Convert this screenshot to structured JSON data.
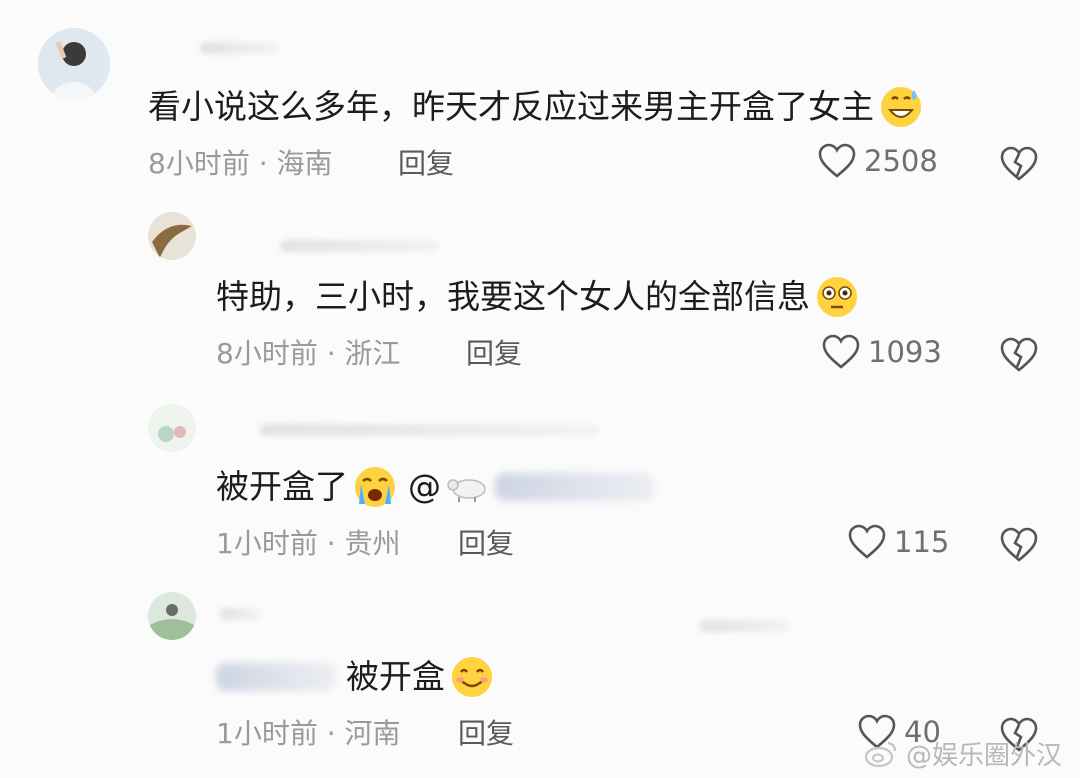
{
  "comments": [
    {
      "text": "看小说这么多年，昨天才反应过来男主开盒了女主",
      "emoji": "grinning-sweat-emoji",
      "time": "8小时前",
      "location": "海南",
      "reply_label": "回复",
      "likes": "2508"
    },
    {
      "text": "特助，三小时，我要这个女人的全部信息",
      "emoji": "flushed-emoji",
      "time": "8小时前",
      "location": "浙江",
      "reply_label": "回复",
      "likes": "1093"
    },
    {
      "text": "被开盒了",
      "emoji": "crying-emoji",
      "mention": "@",
      "time": "1小时前",
      "location": "贵州",
      "reply_label": "回复",
      "likes": "115"
    },
    {
      "text": "被开盒",
      "emoji": "smiling-emoji",
      "time": "1小时前",
      "location": "河南",
      "reply_label": "回复",
      "likes": "40"
    }
  ],
  "separator": " · ",
  "watermark": "@娱乐圈外汉",
  "colors": {
    "text": "#1c1c1c",
    "meta": "#9a9a9a",
    "emoji_face": "#ffd23f",
    "background": "#fbfbfb"
  }
}
